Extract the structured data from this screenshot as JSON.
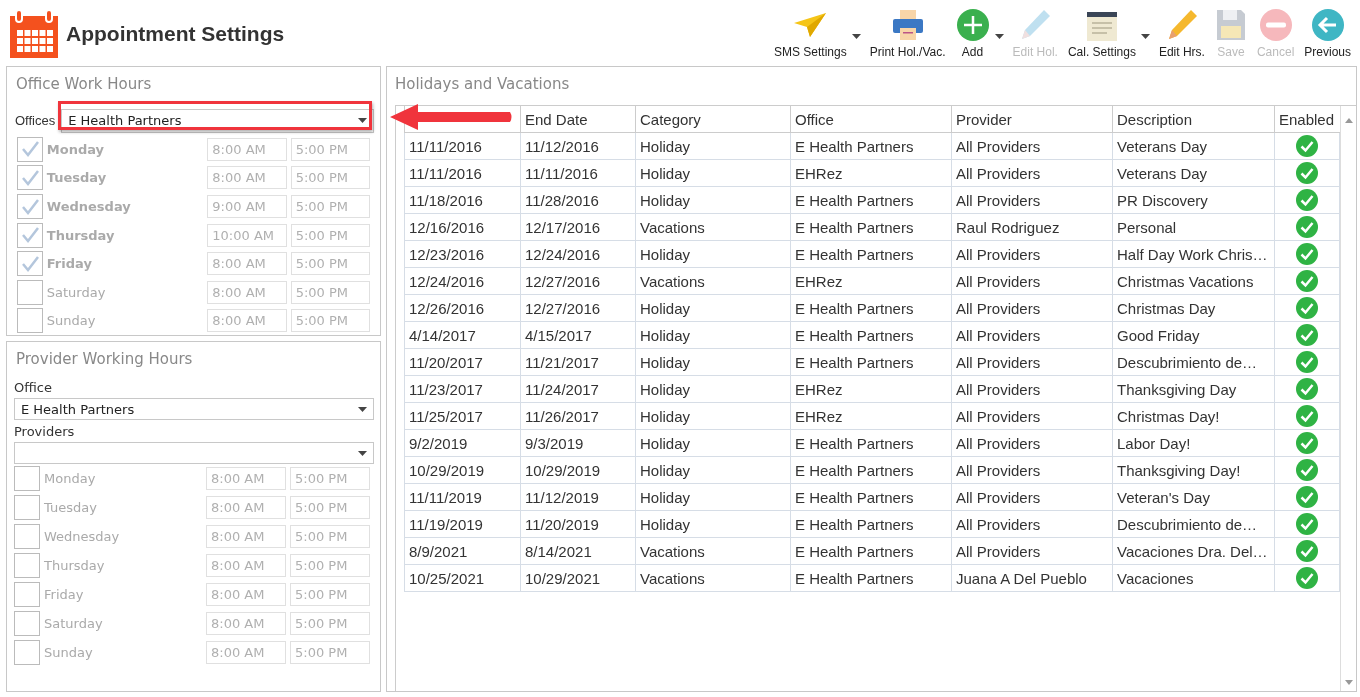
{
  "window": {
    "title": "Appointment Settings"
  },
  "toolbar": [
    {
      "kind": "plane",
      "label": "SMS Settings",
      "disabled": false,
      "dropdown": true
    },
    {
      "kind": "printer",
      "label": "Print Hol./Vac.",
      "disabled": false,
      "dropdown": false
    },
    {
      "kind": "add",
      "label": "Add",
      "disabled": false,
      "dropdown": true
    },
    {
      "kind": "pencil",
      "label": "Edit Hol.",
      "disabled": true,
      "dropdown": false
    },
    {
      "kind": "calendar",
      "label": "Cal. Settings",
      "disabled": false,
      "dropdown": true
    },
    {
      "kind": "pencil",
      "label": "Edit Hrs.",
      "disabled": false,
      "dropdown": false
    },
    {
      "kind": "save",
      "label": "Save",
      "disabled": true,
      "dropdown": false
    },
    {
      "kind": "cancel",
      "label": "Cancel",
      "disabled": true,
      "dropdown": false
    },
    {
      "kind": "back",
      "label": "Previous",
      "disabled": false,
      "dropdown": false
    }
  ],
  "office_work_hours": {
    "title": "Office Work Hours",
    "offices_label": "Offices",
    "office": "E Health Partners",
    "days": [
      {
        "day": "Monday",
        "checked": true,
        "start": "8:00 AM",
        "end": "5:00 PM"
      },
      {
        "day": "Tuesday",
        "checked": true,
        "start": "8:00 AM",
        "end": "5:00 PM"
      },
      {
        "day": "Wednesday",
        "checked": true,
        "start": "9:00 AM",
        "end": "5:00 PM"
      },
      {
        "day": "Thursday",
        "checked": true,
        "start": "10:00 AM",
        "end": "5:00 PM"
      },
      {
        "day": "Friday",
        "checked": true,
        "start": "8:00 AM",
        "end": "5:00 PM"
      },
      {
        "day": "Saturday",
        "checked": false,
        "start": "8:00 AM",
        "end": "5:00 PM"
      },
      {
        "day": "Sunday",
        "checked": false,
        "start": "8:00 AM",
        "end": "5:00 PM"
      }
    ]
  },
  "provider_working_hours": {
    "title": "Provider Working Hours",
    "office_label": "Office",
    "office": "E Health Partners",
    "providers_label": "Providers",
    "days": [
      {
        "day": "Monday",
        "checked": false,
        "start": "8:00 AM",
        "end": "5:00 PM"
      },
      {
        "day": "Tuesday",
        "checked": false,
        "start": "8:00 AM",
        "end": "5:00 PM"
      },
      {
        "day": "Wednesday",
        "checked": false,
        "start": "8:00 AM",
        "end": "5:00 PM"
      },
      {
        "day": "Thursday",
        "checked": false,
        "start": "8:00 AM",
        "end": "5:00 PM"
      },
      {
        "day": "Friday",
        "checked": false,
        "start": "8:00 AM",
        "end": "5:00 PM"
      },
      {
        "day": "Saturday",
        "checked": false,
        "start": "8:00 AM",
        "end": "5:00 PM"
      },
      {
        "day": "Sunday",
        "checked": false,
        "start": "8:00 AM",
        "end": "5:00 PM"
      }
    ]
  },
  "holidays": {
    "title": "Holidays and Vacations",
    "columns": [
      "",
      "End Date",
      "Category",
      "Office",
      "Provider",
      "Description",
      "Enabled"
    ],
    "rows": [
      {
        "cells": [
          "11/11/2016",
          "11/12/2016",
          "Holiday",
          "E Health Partners",
          "All Providers",
          "Veterans Day"
        ],
        "enabled": true
      },
      {
        "cells": [
          "11/11/2016",
          "11/11/2016",
          "Holiday",
          "EHRez",
          "All Providers",
          "Veterans Day"
        ],
        "enabled": true
      },
      {
        "cells": [
          "11/18/2016",
          "11/28/2016",
          "Holiday",
          "E Health Partners",
          "All Providers",
          "PR Discovery"
        ],
        "enabled": true
      },
      {
        "cells": [
          "12/16/2016",
          "12/17/2016",
          "Vacations",
          "E Health Partners",
          "Raul Rodriguez",
          "Personal"
        ],
        "enabled": true
      },
      {
        "cells": [
          "12/23/2016",
          "12/24/2016",
          "Holiday",
          "E Health Partners",
          "All Providers",
          "Half Day Work Chris…"
        ],
        "enabled": true
      },
      {
        "cells": [
          "12/24/2016",
          "12/27/2016",
          "Vacations",
          "EHRez",
          "All Providers",
          "Christmas Vacations"
        ],
        "enabled": true
      },
      {
        "cells": [
          "12/26/2016",
          "12/27/2016",
          "Holiday",
          "E Health Partners",
          "All Providers",
          "Christmas Day"
        ],
        "enabled": true
      },
      {
        "cells": [
          "4/14/2017",
          "4/15/2017",
          "Holiday",
          "E Health Partners",
          "All Providers",
          "Good Friday"
        ],
        "enabled": true
      },
      {
        "cells": [
          "11/20/2017",
          "11/21/2017",
          "Holiday",
          "E Health Partners",
          "All Providers",
          "Descubrimiento de…"
        ],
        "enabled": true
      },
      {
        "cells": [
          "11/23/2017",
          "11/24/2017",
          "Holiday",
          "EHRez",
          "All Providers",
          "Thanksgiving Day"
        ],
        "enabled": true
      },
      {
        "cells": [
          "11/25/2017",
          "11/26/2017",
          "Holiday",
          "EHRez",
          "All Providers",
          "Christmas Day!"
        ],
        "enabled": true
      },
      {
        "cells": [
          "9/2/2019",
          "9/3/2019",
          "Holiday",
          "E Health Partners",
          "All Providers",
          "Labor Day!"
        ],
        "enabled": true
      },
      {
        "cells": [
          "10/29/2019",
          "10/29/2019",
          "Holiday",
          "E Health Partners",
          "All Providers",
          "Thanksgiving Day!"
        ],
        "enabled": true
      },
      {
        "cells": [
          "11/11/2019",
          "11/12/2019",
          "Holiday",
          "E Health Partners",
          "All Providers",
          "Veteran's Day"
        ],
        "enabled": true
      },
      {
        "cells": [
          "11/19/2019",
          "11/20/2019",
          "Holiday",
          "E Health Partners",
          "All Providers",
          "Descubrimiento de…"
        ],
        "enabled": true
      },
      {
        "cells": [
          "8/9/2021",
          "8/14/2021",
          "Vacations",
          "E Health Partners",
          "All Providers",
          "Vacaciones Dra. Del…"
        ],
        "enabled": true
      },
      {
        "cells": [
          "10/25/2021",
          "10/29/2021",
          "Vacations",
          "E Health Partners",
          "Juana A Del Pueblo",
          "Vacaciones"
        ],
        "enabled": true
      }
    ]
  }
}
